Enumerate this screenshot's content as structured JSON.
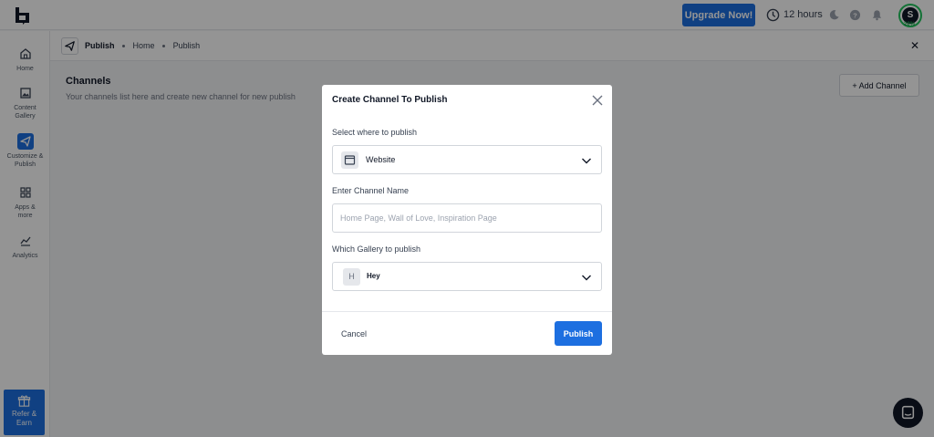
{
  "topbar": {
    "upgrade_label": "Upgrade Now!",
    "hours_text": "12 hours",
    "avatar_letter": "S",
    "avatar_progress": "20%"
  },
  "sidebar": {
    "items": [
      {
        "label": "Home",
        "icon": "home-icon"
      },
      {
        "label": "Content Gallery",
        "icon": "image-icon"
      },
      {
        "label": "Customize & Publish",
        "icon": "send-icon"
      },
      {
        "label": "Apps & more",
        "icon": "grid-icon"
      },
      {
        "label": "Analytics",
        "icon": "chart-icon"
      }
    ],
    "refer_label": "Refer & Earn"
  },
  "subheader": {
    "title": "Publish",
    "crumb1": "Home",
    "crumb2": "Publish"
  },
  "main": {
    "title": "Channels",
    "subtitle": "Your channels list here and create new channel for new publish",
    "add_channel_label": "+ Add Channel"
  },
  "modal": {
    "title": "Create Channel To Publish",
    "where_label": "Select where to publish",
    "where_value": "Website",
    "name_label": "Enter Channel Name",
    "name_placeholder": "Home Page, Wall of Love, Inspiration Page",
    "gallery_label": "Which Gallery to publish",
    "gallery_letter": "H",
    "gallery_value": "Hey",
    "cancel_label": "Cancel",
    "publish_label": "Publish"
  },
  "colors": {
    "accent": "#1d6fe0",
    "avatar_ring": "#22c55e"
  }
}
